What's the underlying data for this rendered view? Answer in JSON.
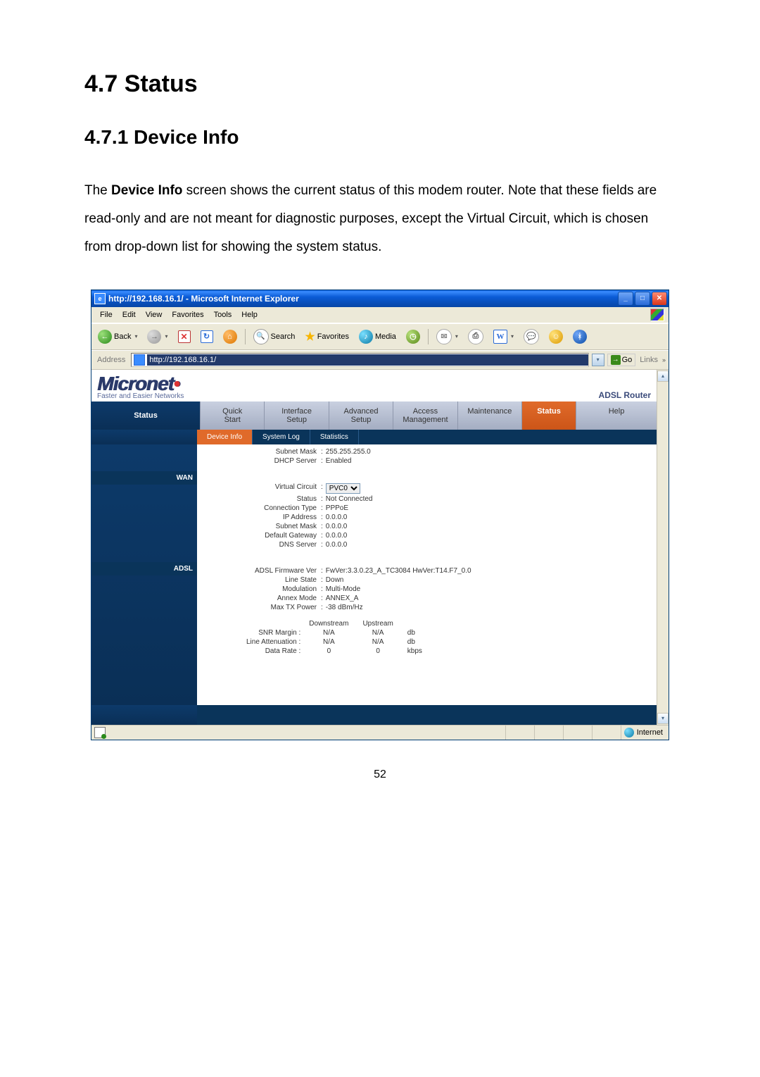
{
  "doc": {
    "section": "4.7 Status",
    "subsection": "4.7.1 Device Info",
    "para_prefix": "The ",
    "para_bold": "Device Info",
    "para_suffix": " screen shows the current status of this modem router. Note that these fields are read-only and are not meant for diagnostic purposes, except the Virtual Circuit, which is chosen from drop-down list for showing the system status.",
    "page_number": "52"
  },
  "browser": {
    "window_title": "http://192.168.16.1/ - Microsoft Internet Explorer",
    "menus": [
      "File",
      "Edit",
      "View",
      "Favorites",
      "Tools",
      "Help"
    ],
    "toolbar": {
      "back": "Back",
      "search": "Search",
      "favorites": "Favorites",
      "media": "Media"
    },
    "address_label": "Address",
    "address_value": "http://192.168.16.1/",
    "go_label": "Go",
    "links_label": "Links",
    "statusbar_zone": "Internet"
  },
  "router": {
    "brand": "Micronet",
    "brand_sub": "Faster and Easier Networks",
    "product": "ADSL Router",
    "tabs": {
      "quick_start": "Quick\nStart",
      "interface_setup": "Interface\nSetup",
      "advanced_setup": "Advanced\nSetup",
      "access_management": "Access\nManagement",
      "maintenance": "Maintenance",
      "status": "Status",
      "help": "Help"
    },
    "subtabs": {
      "device_info": "Device Info",
      "system_log": "System Log",
      "statistics": "Statistics"
    },
    "side": {
      "wan": "WAN",
      "adsl": "ADSL"
    },
    "lan": {
      "subnet_mask_label": "Subnet Mask",
      "subnet_mask": "255.255.255.0",
      "dhcp_server_label": "DHCP Server",
      "dhcp_server": "Enabled"
    },
    "wan": {
      "virtual_circuit_label": "Virtual Circuit",
      "virtual_circuit": "PVC0",
      "status_label": "Status",
      "status": "Not Connected",
      "conn_type_label": "Connection Type",
      "conn_type": "PPPoE",
      "ip_label": "IP Address",
      "ip": "0.0.0.0",
      "subnet_mask_label": "Subnet Mask",
      "subnet_mask": "0.0.0.0",
      "gateway_label": "Default Gateway",
      "gateway": "0.0.0.0",
      "dns_label": "DNS Server",
      "dns": "0.0.0.0"
    },
    "adsl": {
      "fw_label": "ADSL Firmware Ver",
      "fw": "FwVer:3.3.0.23_A_TC3084 HwVer:T14.F7_0.0",
      "line_state_label": "Line State",
      "line_state": "Down",
      "modulation_label": "Modulation",
      "modulation": "Multi-Mode",
      "annex_label": "Annex Mode",
      "annex": "ANNEX_A",
      "maxtx_label": "Max TX Power",
      "maxtx": "-38 dBm/Hz",
      "rates": {
        "down_h": "Downstream",
        "up_h": "Upstream",
        "snr_label": "SNR Margin",
        "snr_down": "N/A",
        "snr_up": "N/A",
        "snr_unit": "db",
        "la_label": "Line Attenuation",
        "la_down": "N/A",
        "la_up": "N/A",
        "la_unit": "db",
        "dr_label": "Data Rate",
        "dr_down": "0",
        "dr_up": "0",
        "dr_unit": "kbps"
      }
    }
  }
}
